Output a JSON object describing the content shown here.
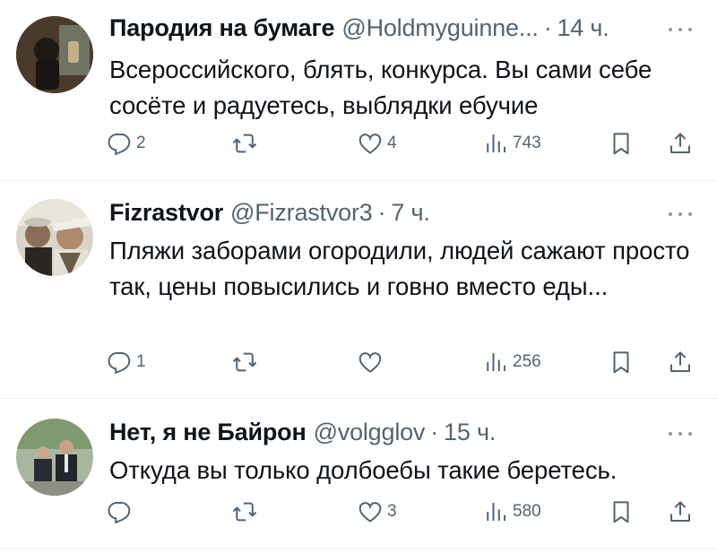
{
  "tweets": [
    {
      "display_name": "Пародия на бумаге",
      "handle": "@Holdmyguinne...",
      "separator": "·",
      "time": "14 ч.",
      "text": "Всероссийского, блять, конкурса. Вы сами себе сосёте и радуетесь, выблядки ебучие",
      "replies": "2",
      "retweets": "",
      "likes": "4",
      "views": "743"
    },
    {
      "display_name": "Fizrastvor",
      "handle": "@Fizrastvor3",
      "separator": "·",
      "time": "7 ч.",
      "text": "Пляжи заборами огородили, людей сажают просто так, цены повысились и говно вместо еды...",
      "replies": "1",
      "retweets": "",
      "likes": "",
      "views": "256"
    },
    {
      "display_name": "Нет, я не Байрон",
      "handle": "@volgglov",
      "separator": "·",
      "time": "15 ч.",
      "text": "Откуда вы только долбоебы такие беретесь.",
      "replies": "",
      "retweets": "",
      "likes": "3",
      "views": "580"
    }
  ],
  "colors": {
    "text_primary": "#0f1419",
    "text_secondary": "#536471",
    "divider": "#eff3f4"
  },
  "icons": [
    "reply-icon",
    "retweet-icon",
    "like-icon",
    "views-icon",
    "bookmark-icon",
    "share-icon",
    "more-icon"
  ]
}
